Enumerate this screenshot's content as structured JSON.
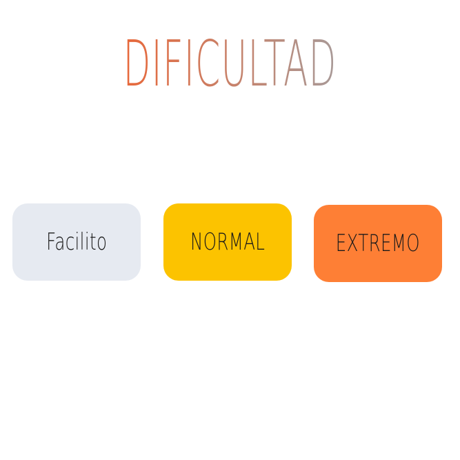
{
  "title": {
    "text": "DIFICULTAD",
    "gradient_start": "#e8683a",
    "gradient_end": "#a89a98"
  },
  "buttons": [
    {
      "label": "Facilito",
      "color": "#e6eaf1"
    },
    {
      "label": "NORMAL",
      "color": "#fcc300"
    },
    {
      "label": "EXTREMO",
      "color": "#fe7f35"
    }
  ]
}
